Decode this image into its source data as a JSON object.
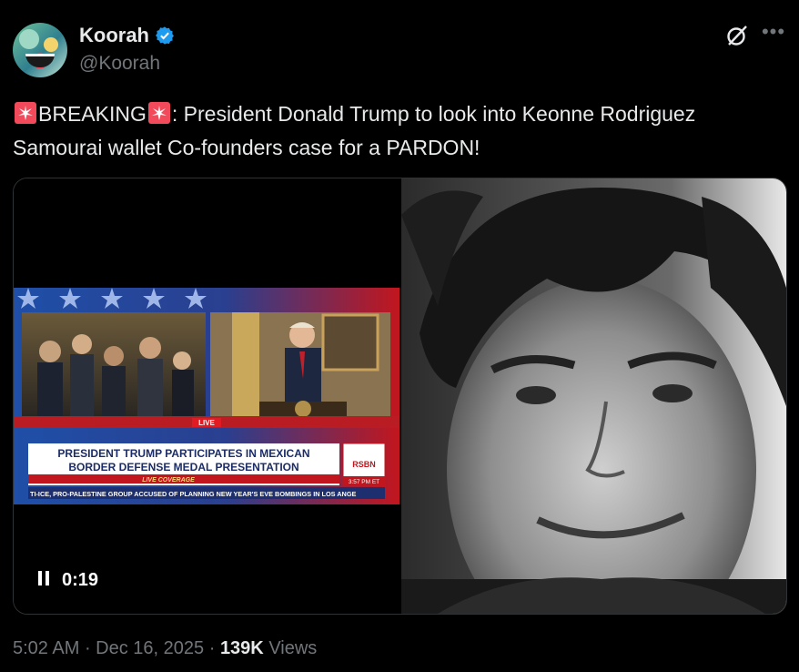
{
  "author": {
    "display_name": "Koorah",
    "handle": "@Koorah",
    "verified": true,
    "verified_color": "#1d9bf0"
  },
  "tweet": {
    "prefix_emoji": "rotating-light",
    "breaking_label": "BREAKING",
    "body_text": ": President Donald Trump to look into Keonne Rodriguez Samourai wallet Co-founders case for a PARDON!"
  },
  "video": {
    "elapsed": "0:19",
    "state": "playing",
    "broadcast": {
      "live_tag": "LIVE",
      "headline_line1": "PRESIDENT TRUMP PARTICIPATES IN MEXICAN",
      "headline_line2": "BORDER DEFENSE MEDAL PRESENTATION",
      "coverage": "LIVE COVERAGE",
      "network": "RSBN",
      "clock": "3:57 PM ET",
      "ticker": "TI-ICE, PRO-PALESTINE GROUP ACCUSED OF PLANNING NEW YEAR'S EVE BOMBINGS IN LOS ANGE"
    }
  },
  "footer": {
    "time": "5:02 AM",
    "date": "Dec 16, 2025",
    "views_count": "139K",
    "views_label": "Views"
  }
}
